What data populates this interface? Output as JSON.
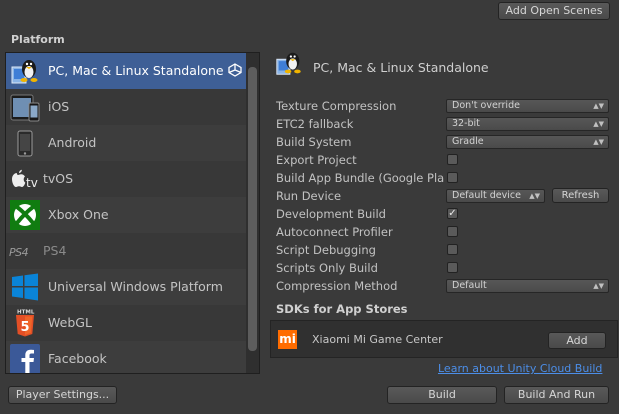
{
  "header": {
    "add_open_scenes": "Add Open Scenes"
  },
  "platform_heading": "Platform",
  "platforms": [
    {
      "label": "PC, Mac & Linux Standalone",
      "icon": "pc-mac-linux-icon",
      "selected": true
    },
    {
      "label": "iOS",
      "icon": "ios-device-icon"
    },
    {
      "label": "Android",
      "icon": "android-icon"
    },
    {
      "label": "tvOS",
      "icon": "apple-tv-icon"
    },
    {
      "label": "Xbox One",
      "icon": "xbox-icon"
    },
    {
      "label": "PS4",
      "icon": "ps4-icon"
    },
    {
      "label": "Universal Windows Platform",
      "icon": "windows-icon"
    },
    {
      "label": "WebGL",
      "icon": "html5-icon"
    },
    {
      "label": "Facebook",
      "icon": "facebook-icon"
    }
  ],
  "selected_platform": {
    "title": "PC, Mac & Linux Standalone"
  },
  "settings": {
    "texture_compression": {
      "label": "Texture Compression",
      "value": "Don't override"
    },
    "etc2_fallback": {
      "label": "ETC2 fallback",
      "value": "32-bit"
    },
    "build_system": {
      "label": "Build System",
      "value": "Gradle"
    },
    "export_project": {
      "label": "Export Project",
      "checked": false
    },
    "build_app_bundle": {
      "label": "Build App Bundle (Google Pla",
      "checked": false
    },
    "run_device": {
      "label": "Run Device",
      "value": "Default device",
      "refresh": "Refresh"
    },
    "development_build": {
      "label": "Development Build",
      "checked": true,
      "mark": "✓"
    },
    "autoconnect_profiler": {
      "label": "Autoconnect Profiler",
      "checked": false
    },
    "script_debugging": {
      "label": "Script Debugging",
      "checked": false
    },
    "scripts_only_build": {
      "label": "Scripts Only Build",
      "checked": false
    },
    "compression_method": {
      "label": "Compression Method",
      "value": "Default"
    }
  },
  "sdks": {
    "heading": "SDKs for App Stores",
    "items": [
      {
        "logo_text": "mi",
        "name": "Xiaomi Mi Game Center",
        "add_label": "Add"
      }
    ]
  },
  "cloud_build_link": "Learn about Unity Cloud Build",
  "footer": {
    "player_settings": "Player Settings...",
    "build": "Build",
    "build_and_run": "Build And Run"
  },
  "colors": {
    "selection": "#3e5f96",
    "link": "#4c8ee8",
    "xiaomi": "#ff6c00",
    "xbox": "#107c10",
    "windows": "#0078d7",
    "html5": "#e34f26",
    "facebook": "#3b5998"
  }
}
